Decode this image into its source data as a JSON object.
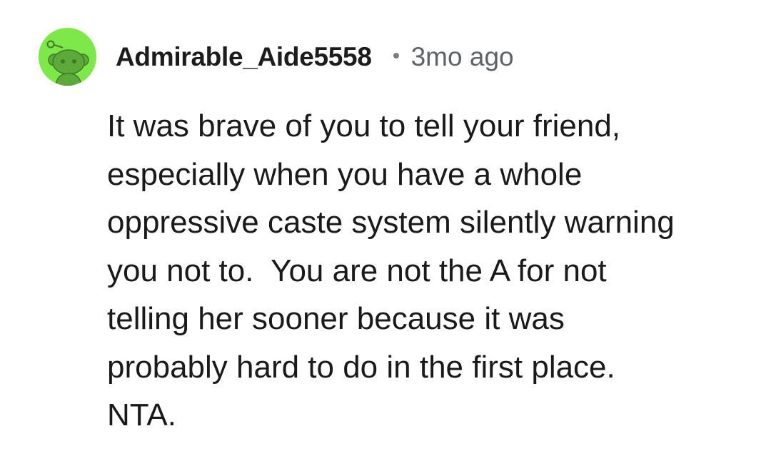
{
  "comment": {
    "author": "Admirable_Aide5558",
    "separator_icon": "dot-icon",
    "timestamp": "3mo ago",
    "avatar_icon": "snoo-avatar-icon",
    "avatar_bg": "#7ee84a",
    "avatar_fg": "#5daa3a",
    "body_lines": [
      "It was brave of you to tell your friend,",
      "especially when you have a whole",
      "oppressive caste system silently warning",
      "you not to.  You are not the A for not",
      "telling her sooner because it was",
      "probably hard to do in the first place.",
      "NTA."
    ]
  }
}
